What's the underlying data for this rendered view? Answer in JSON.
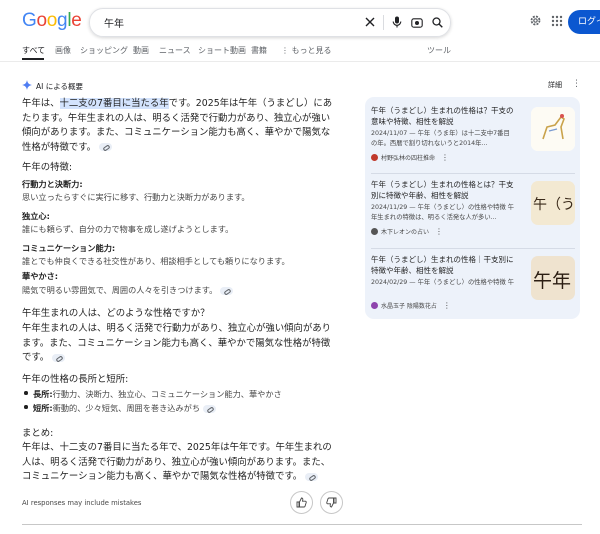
{
  "header": {
    "logo": [
      "G",
      "o",
      "o",
      "g",
      "l",
      "e"
    ],
    "logo_colors": [
      "#4285F4",
      "#EA4335",
      "#FBBC05",
      "#4285F4",
      "#34A853",
      "#EA4335"
    ],
    "query": "午年",
    "login_label": "ログイ"
  },
  "tabs": {
    "all": "すべて",
    "images": "画像",
    "shopping": "ショッピング",
    "videos": "動画",
    "news": "ニュース",
    "shorts": "ショート動画",
    "books": "書籍",
    "more": "⋮ もっと見る",
    "tools": "ツール"
  },
  "ai": {
    "heading": "AI による概要",
    "details": "詳細",
    "intro_pre": "午年は、",
    "intro_hl": "十二支の7番目に当たる年",
    "intro_line1_rest": "です。2025年は午年（うまどし）にあ",
    "intro_line2": "たります。午年生まれの人は、明るく活発で行動力があり、独立心が強い",
    "intro_line3": "傾向があります。また、コミュニケーション能力も高く、華やかで陽気な",
    "intro_line4": "性格が特徴です。",
    "traits_heading": "午年の特徴:",
    "traits": [
      {
        "title": "行動力と決断力:",
        "desc": "思い立ったらすぐに実行に移す、行動力と決断力があります。"
      },
      {
        "title": "独立心:",
        "desc": "誰にも頼らず、自分の力で物事を成し遂げようとします。"
      },
      {
        "title": "コミュニケーション能力:",
        "desc": "誰とでも仲良くできる社交性があり、相談相手としても頼りになります。"
      },
      {
        "title": "華やかさ:",
        "desc": "陽気で明るい雰囲気で、周囲の人々を引きつけます。"
      }
    ],
    "q_heading": "午年生まれの人は、どのような性格ですか？",
    "q_line1": "午年生まれの人は、明るく活発で行動力があり、独立心が強い傾向があり",
    "q_line2": "ます。また、コミュニケーション能力も高く、華やかで陽気な性格が特徴",
    "q_line3": "です。",
    "ps_heading": "午年の性格の長所と短所:",
    "pros_label": "長所:",
    "pros": "行動力、決断力、独立心、コミュニケーション能力、華やかさ",
    "cons_label": "短所:",
    "cons": "衝動的、少々短気、周囲を巻き込みがち",
    "summary_heading": "まとめ:",
    "summary_line1": "午年は、十二支の7番目に当たる年で、2025年は午年です。午年生まれの",
    "summary_line2": "人は、明るく活発で行動力があり、独立心が強い傾向があります。また、",
    "summary_line3": "コミュニケーション能力も高く、華やかで陽気な性格が特徴です。",
    "disclaimer": "AI responses may include mistakes"
  },
  "sources": [
    {
      "title": "午年（うまどし）生まれの性格は？干支の意味や特徴、相性を解説",
      "snippet": "2024/11/07 — 午年（うま年）は十二支中7番目の年。西暦で割り切れないうと2014年...",
      "site": "村野弘林の四柱推命",
      "fav_color": "#c0392b",
      "thumb_text": ""
    },
    {
      "title": "午年（うまどし）生まれの性格とは？干支別に特徴や年齢、相性を解説",
      "snippet": "2024/11/29 — 午年（うまどし）の性格や特徴 午年生まれの特徴は、明るく活発な人が多い...",
      "site": "木下レオンの占い",
      "fav_color": "#555555",
      "thumb_text": "午（うま"
    },
    {
      "title": "午年（うまどし）生まれの性格｜干支別に特徴や年齢、相性を解説",
      "snippet": "2024/02/29 — 午年（うまどし）の性格や特徴 午年生まれの人は、活発な性格です。...",
      "site": "水晶玉子 陰陽数花占",
      "fav_color": "#8e44ad",
      "thumb_text": "午年"
    }
  ]
}
